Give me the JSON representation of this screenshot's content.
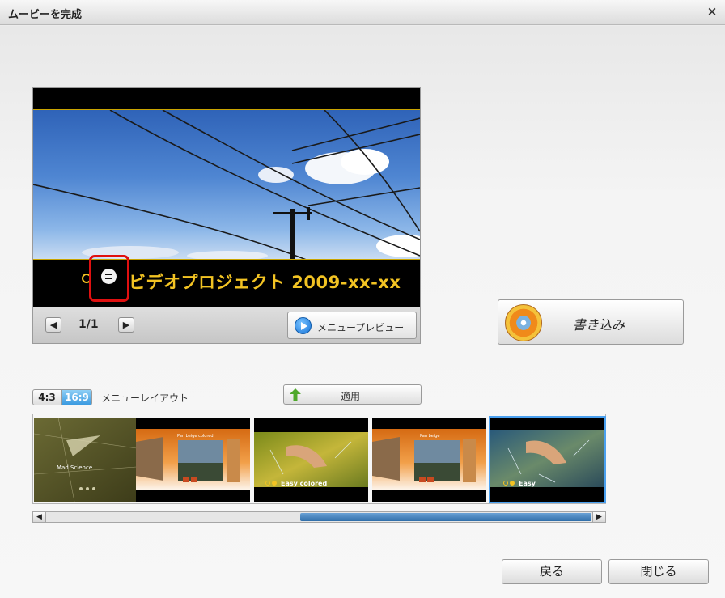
{
  "window": {
    "title": "ムービーを完成",
    "close_glyph": "×"
  },
  "preview": {
    "menu_title": "ビデオプロジェクト 2009-xx-xx",
    "page_indicator": "1/1",
    "prev_glyph": "◀",
    "next_glyph": "▶",
    "menu_preview_label": "メニュープレビュー"
  },
  "burn": {
    "label": "書き込み"
  },
  "layout": {
    "ratio_options": [
      "4:3",
      "16:9"
    ],
    "ratio_selected": "16:9",
    "label": "メニューレイアウト",
    "apply_label": "適用",
    "templates": [
      {
        "name": "Mad Science",
        "caption": "Mad Science",
        "selected": false
      },
      {
        "name": "Pan beige colored",
        "caption": "Pan beige colored",
        "selected": false
      },
      {
        "name": "Easy colored",
        "caption": "Easy colored",
        "selected": false
      },
      {
        "name": "Pan beige",
        "caption": "Pan beige",
        "selected": false
      },
      {
        "name": "Easy",
        "caption": "Easy",
        "selected": true
      }
    ]
  },
  "scrollbar": {
    "left_glyph": "◀",
    "right_glyph": "▶"
  },
  "footer": {
    "back_label": "戻る",
    "close_label": "閉じる"
  },
  "colors": {
    "menu_text": "#f2c323",
    "highlight_border": "#e01010",
    "selection": "#4aa0ef",
    "scroll_thumb": "#2f6ea9"
  }
}
